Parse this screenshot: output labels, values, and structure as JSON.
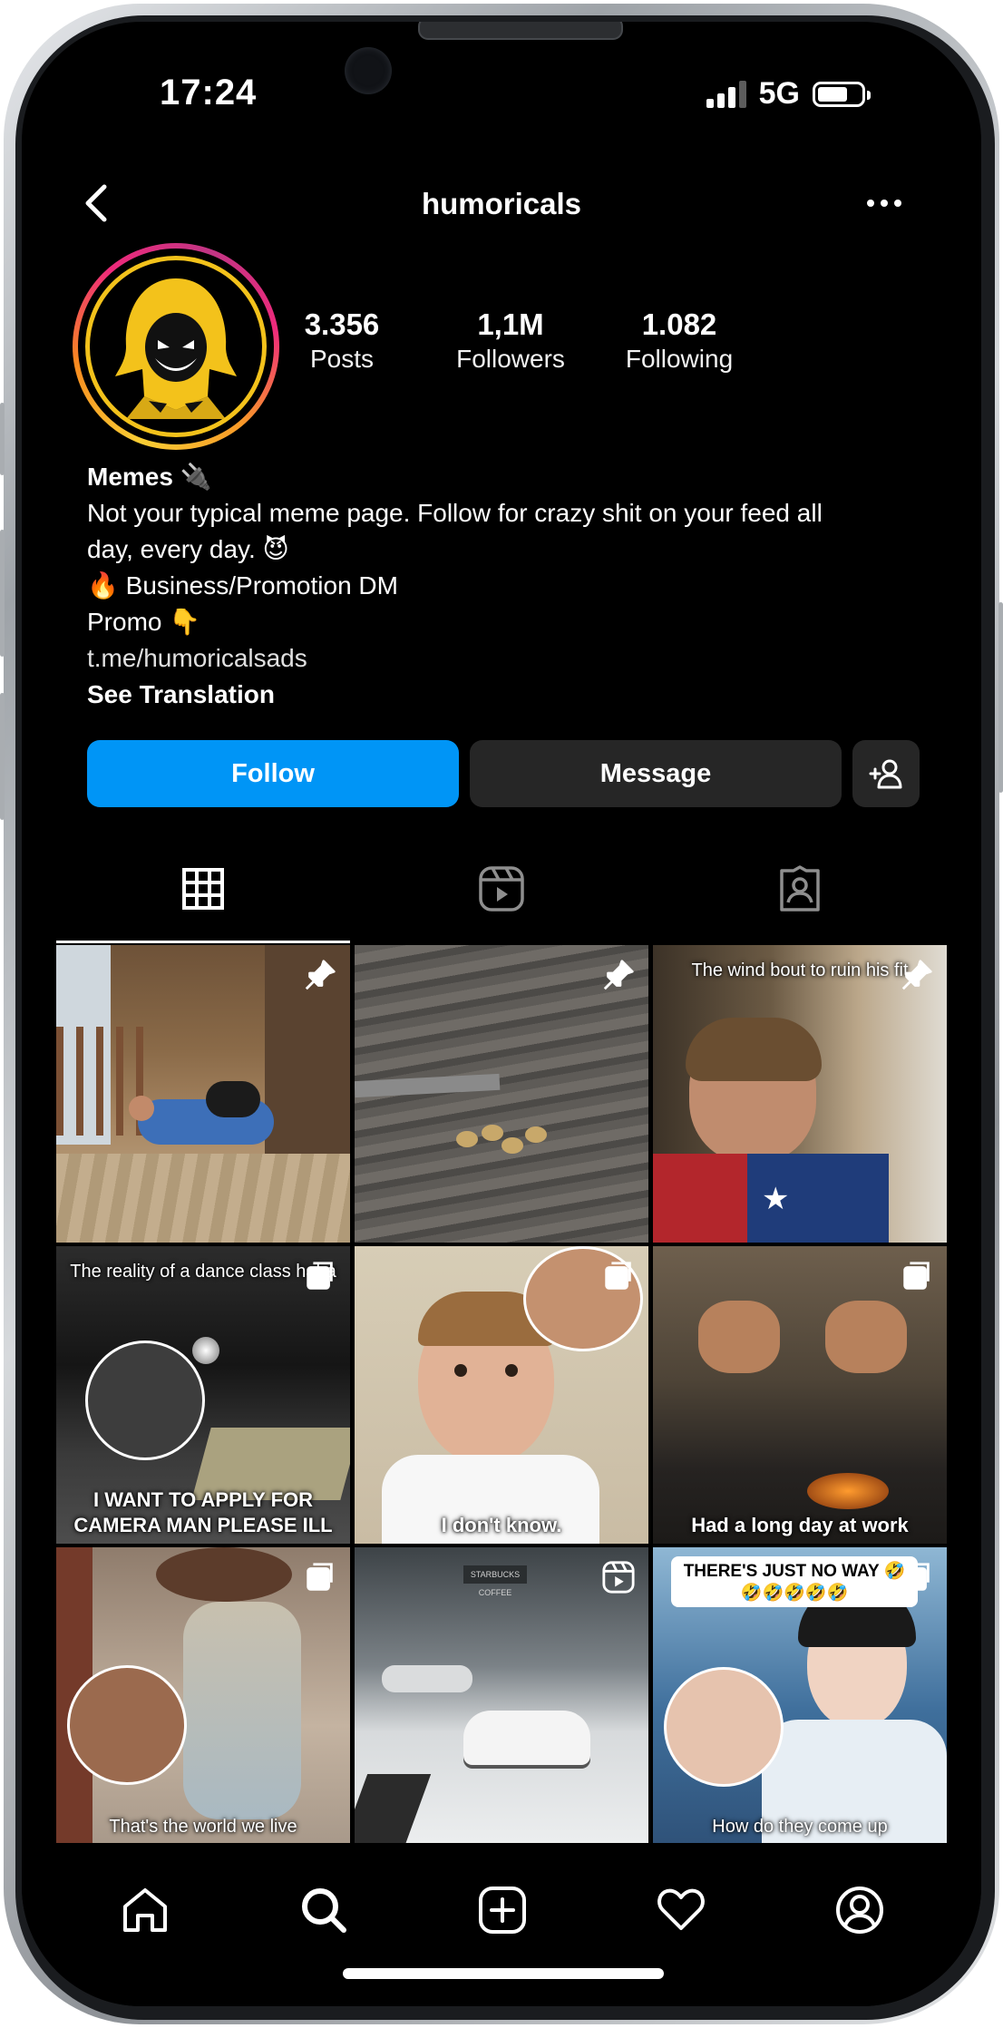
{
  "status_bar": {
    "time": "17:24",
    "network": "5G",
    "battery_level": 0.7,
    "signal_bars_active": 3
  },
  "header": {
    "username": "humoricals"
  },
  "profile": {
    "stats": [
      {
        "value": "3.356",
        "label": "Posts"
      },
      {
        "value": "1,1M",
        "label": "Followers"
      },
      {
        "value": "1.082",
        "label": "Following"
      }
    ],
    "bio": {
      "name": "Memes 🔌",
      "line1": "Not your typical meme page. Follow for crazy shit on your feed all",
      "line2": "day, every day. 😈",
      "line3": "🔥 Business/Promotion DM",
      "line4": "Promo 👇",
      "link": "t.me/humoricalsads",
      "translate": "See Translation"
    }
  },
  "actions": {
    "follow_label": "Follow",
    "message_label": "Message"
  },
  "tabs": [
    "posts-grid-icon",
    "reels-icon",
    "tagged-icon"
  ],
  "grid": {
    "tile3_caption": "The wind bout to ruin his fit",
    "tile4_caption_top": "The reality of a dance class haha",
    "tile4_caption_bottom": "I WANT TO APPLY FOR CAMERA MAN PLEASE ILL",
    "tile5_caption": "I don't know.",
    "tile6_caption": "Had a long day at work",
    "tile7_caption": "That's the world we live",
    "tile8_sign": "STARBUCKS COFFEE",
    "tile9_pill": "THERE'S JUST NO WAY 🤣 🤣🤣🤣🤣🤣",
    "tile9_caption": "How do they come up"
  },
  "bottom_nav": [
    "home-icon",
    "search-icon",
    "create-icon",
    "activity-icon",
    "profile-icon"
  ],
  "colors": {
    "follow_button": "#0095f6",
    "secondary_button": "#262626",
    "background": "#000000"
  }
}
